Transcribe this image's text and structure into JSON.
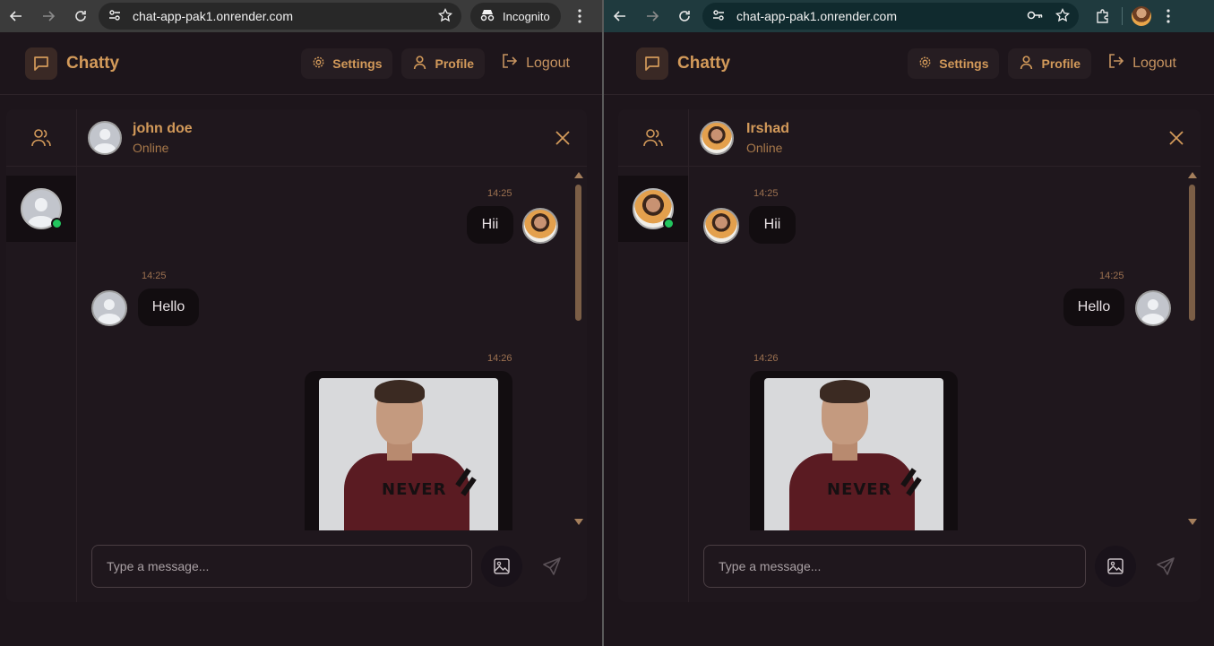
{
  "left_window": {
    "url": "chat-app-pak1.onrender.com",
    "incognito_label": "Incognito",
    "app": {
      "brand": "Chatty",
      "nav": {
        "settings": "Settings",
        "profile": "Profile",
        "logout": "Logout"
      },
      "chat_header": {
        "name": "john doe",
        "status": "Online"
      },
      "messages": [
        {
          "time": "14:25",
          "text": "Hii",
          "side": "right",
          "avatar": "photo"
        },
        {
          "time": "14:25",
          "text": "Hello",
          "side": "left",
          "avatar": "default"
        },
        {
          "time": "14:26",
          "text": "",
          "side": "right",
          "attachment": "image"
        }
      ],
      "composer": {
        "placeholder": "Type a message..."
      }
    }
  },
  "right_window": {
    "url": "chat-app-pak1.onrender.com",
    "app": {
      "brand": "Chatty",
      "nav": {
        "settings": "Settings",
        "profile": "Profile",
        "logout": "Logout"
      },
      "chat_header": {
        "name": "Irshad",
        "status": "Online"
      },
      "messages": [
        {
          "time": "14:25",
          "text": "Hii",
          "side": "left",
          "avatar": "photo"
        },
        {
          "time": "14:25",
          "text": "Hello",
          "side": "right",
          "avatar": "default"
        },
        {
          "time": "14:26",
          "text": "",
          "side": "left",
          "attachment": "image"
        }
      ],
      "composer": {
        "placeholder": "Type a message..."
      }
    }
  },
  "image_text": "NEVER",
  "colors": {
    "accent": "#d39a5a",
    "online": "#22c55e",
    "background": "#1d151b",
    "bubble": "#120d10"
  }
}
